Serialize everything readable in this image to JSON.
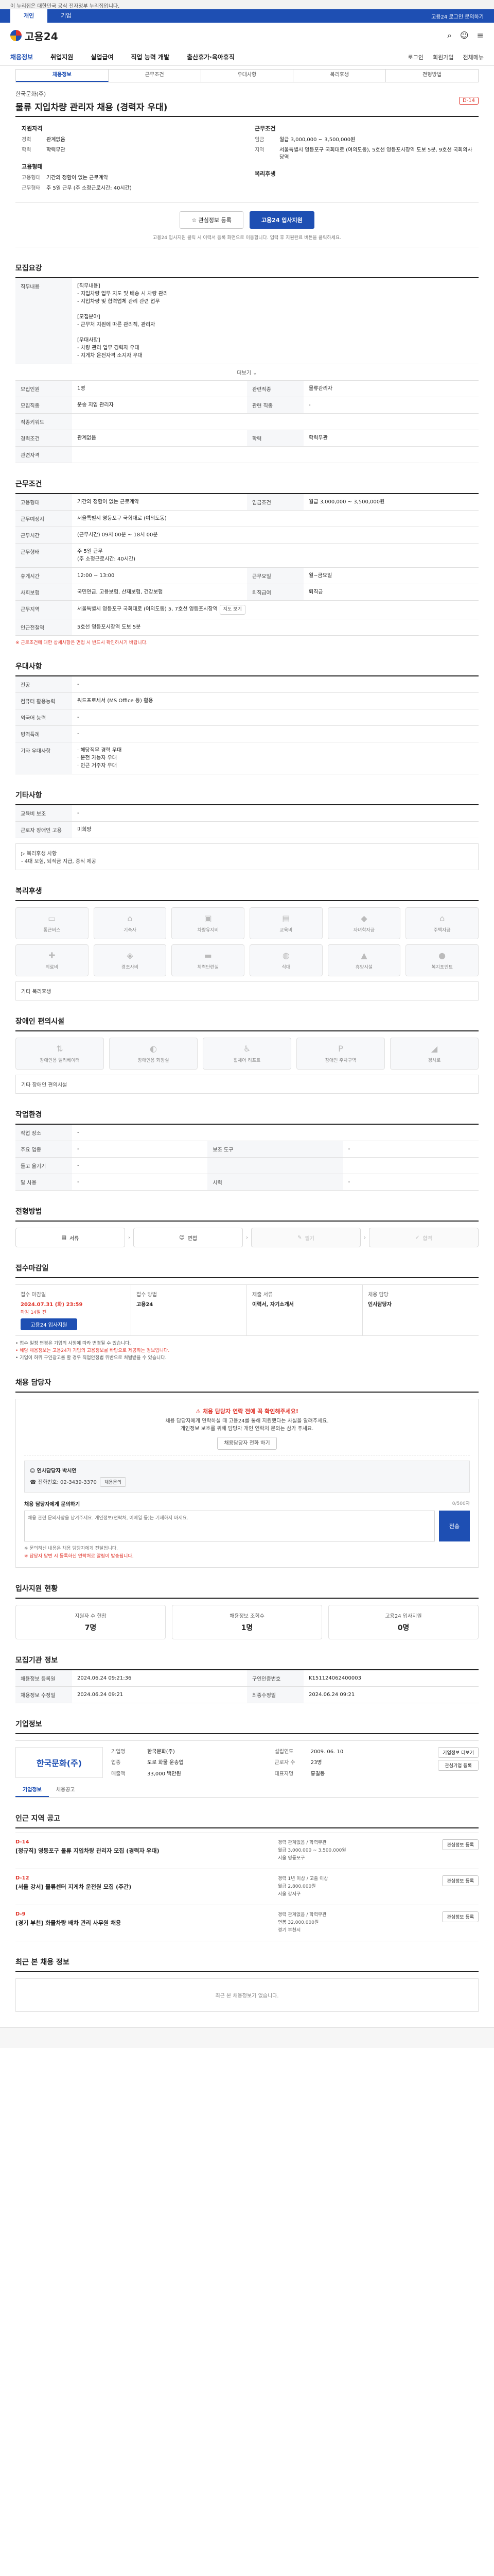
{
  "gov_bar": "이 누리집은 대한민국 공식 전자정부 누리집입니다.",
  "topnav": {
    "tabs": [
      "개인",
      "기업"
    ],
    "right": "고용24 로그인 문의하기"
  },
  "header": {
    "logo": "고용24"
  },
  "mainmenu": {
    "items": [
      "채용정보",
      "취업지원",
      "실업급여",
      "직업 능력 개발",
      "출산휴가·육아휴직"
    ],
    "right": [
      "로그인",
      "회원가입",
      "전체메뉴"
    ]
  },
  "subtabs": [
    "채용정보",
    "근무조건",
    "우대사항",
    "복리후생",
    "전형방법"
  ],
  "job": {
    "company": "한국문화(주)",
    "title": "물류 지입차량 관리자 채용 (경력자 우대)",
    "dday": "D-14"
  },
  "summary": {
    "left_title": "지원자격",
    "left": [
      {
        "k": "경력",
        "v": "관계없음"
      },
      {
        "k": "학력",
        "v": "학력무관"
      }
    ],
    "right_title": "근무조건",
    "right": [
      {
        "k": "임금",
        "v": "월급 3,000,000 ~ 3,500,000원"
      },
      {
        "k": "지역",
        "v": "서울특별시 영등포구 국회대로 (여의도동), 5호선 영등포시장역 도보 5분, 9호선 국회의사당역"
      }
    ],
    "left2_title": "고용형태",
    "left2": [
      {
        "k": "고용형태",
        "v": "기간의 정함이 없는 근로계약"
      },
      {
        "k": "근무형태",
        "v": "주 5일 근무 (주 소정근로시간: 40시간)"
      }
    ],
    "right2_title": "복리후생",
    "right2": []
  },
  "actions": {
    "save": "관심정보 등록",
    "apply": "고용24 입사지원",
    "notice": "고용24 입사지원 클릭 시 이력서 등록 화면으로 이동합니다. 입력 후 지원완료 버튼을 클릭하세요."
  },
  "recruit": {
    "title": "모집요강",
    "duty_label": "직무내용",
    "duty": "[직무내용]\n - 지입차량 업무 지도 및 배송 시 차량 관리\n - 지입차량 및 협력업체 관리 관련 업무\n\n[모집분야]\n - 근무처 지원에 따른 관리직, 관리자\n\n[우대사항]\n - 차량 관리 업무 경력자 우대\n - 지게차 운전자격 소지자 우대",
    "more": "더보기",
    "rows": [
      {
        "k": "모집인원",
        "v": "1명",
        "k2": "관련직종",
        "v2": "물류관리자"
      },
      {
        "k": "모집직종",
        "v": "운송 지입 관리자",
        "k2": "관련 직종",
        "v2": "-"
      },
      {
        "k": "직종키워드",
        "v": "",
        "k2": "",
        "v2": ""
      },
      {
        "k": "경력조건",
        "v": "관계없음",
        "k2": "학력",
        "v2": "학력무관"
      },
      {
        "k": "관련자격",
        "v": "",
        "k2": "",
        "v2": ""
      }
    ]
  },
  "conditions": {
    "title": "근무조건",
    "rows": [
      {
        "k": "고용형태",
        "v": "기간의 정함이 없는 근로계약",
        "k2": "임금조건",
        "v2": "월급 3,000,000 ~ 3,500,000원"
      },
      {
        "k": "근무예정지",
        "v": "서울특별시 영등포구 국회대로 (여의도동)"
      },
      {
        "k": "근무시간",
        "v": "(근무시간) 09시 00분 ~ 18시 00분"
      },
      {
        "k": "근무형태",
        "v": "주 5일 근무\n(주 소정근로시간: 40시간)"
      },
      {
        "k": "휴게시간",
        "v": "12:00 ~ 13:00",
        "k2": "근무요일",
        "v2": "월~금요일"
      },
      {
        "k": "사회보험",
        "v": "국민연금, 고용보험, 산재보험, 건강보험",
        "k2": "퇴직급여",
        "v2": "퇴직금"
      },
      {
        "k": "근무지역",
        "v": "서울특별시 영등포구 국회대로 (여의도동) 5, 7호선 영등포시장역"
      },
      {
        "k": "인근전철역",
        "v": "5호선 영등포시장역 도보 5분"
      }
    ],
    "note": "※ 근로조건에 대한 상세사항은 면접 시 반드시 확인하시기 바랍니다."
  },
  "preferences": {
    "title": "우대사항",
    "rows": [
      {
        "k": "전공",
        "v": "-"
      },
      {
        "k": "컴퓨터 활용능력",
        "v": "워드프로세서 (MS Office 등) 활용"
      },
      {
        "k": "외국어 능력",
        "v": "-"
      },
      {
        "k": "병역특례",
        "v": "-"
      },
      {
        "k": "기타 우대사항",
        "v": "· 해당직무 경력 우대\n· 운전 가능자 우대\n· 인근 거주자 우대"
      }
    ]
  },
  "welfare_detail": {
    "title": "기타사항",
    "rows": [
      {
        "k": "교육비 보조",
        "v": "-"
      },
      {
        "k": "근로자 장애인 고용",
        "v": "미희망"
      }
    ],
    "extra": "▷ 복리후생 사항\n - 4대 보험, 퇴직금 지급, 중식 제공"
  },
  "benefits": {
    "title": "복리후생",
    "items": [
      "통근버스",
      "기숙사",
      "차량유지비",
      "교육비",
      "자녀학자금",
      "주택자금",
      "의료비",
      "경조사비",
      "체력단련실",
      "식대",
      "휴양시설",
      "복지포인트"
    ]
  },
  "disability": {
    "title": "장애인 편의시설",
    "items": [
      "장애인용 엘리베이터",
      "장애인용 화장실",
      "휠체어 리프트",
      "장애인 주차구역",
      "경사로"
    ],
    "etc": "기타 장애인 편의시설"
  },
  "workplace": {
    "title": "작업환경",
    "rows": [
      {
        "k": "작업 장소",
        "v": "-"
      },
      {
        "k": "주요 업종",
        "v": "-",
        "k2": "보조 도구",
        "v2": "-"
      },
      {
        "k": "들고 옮기기",
        "v": "-",
        "k2": "",
        "v2": ""
      },
      {
        "k": "말 사용",
        "v": "-",
        "k2": "시력",
        "v2": "-"
      }
    ]
  },
  "process": {
    "title": "전형방법",
    "steps": [
      "서류",
      "면접",
      "필기",
      "합격"
    ]
  },
  "apply": {
    "title": "접수마감일",
    "deadline_label": "접수 마감일",
    "deadline": "2024.07.31 (화) 23:59",
    "deadline_red": "마감 14일 전",
    "method_label": "접수 방법",
    "method": "고용24",
    "docs_label": "제출 서류",
    "docs": "이력서, 자기소개서",
    "contact_label": "채용 담당",
    "contact": "인사담당자",
    "button": "고용24 입사지원",
    "notes": [
      "접수 일정 변경은 기업의 사정에 따라 변경될 수 있습니다.",
      "해당 채용정보는 고용24가 기업의 고용정보를 바탕으로 제공하는 정보입니다.",
      "기업이 허위 구인광고를 할 경우 직업안정법 위반으로 처벌받을 수 있습니다."
    ]
  },
  "contact": {
    "title": "채용 담당자",
    "warn_title": "채용 담당자 연락 전에 꼭 확인해주세요!",
    "warn": "채용 담당자에게 연락하실 때 고용24를 통해 지원했다는 사실을 알려주세요.\n개인정보 보호를 위해 담당자 개인 연락처 문의는 삼가 주세요.",
    "warn_btn": "채용담당자 전화 하기",
    "name": "인사담당자 박시연",
    "tel": "전화번호: 02-3439-3370",
    "more_btn": "채용문의"
  },
  "inquiry": {
    "title": "채용 담당자에게 문의하기",
    "count": "0/500자",
    "placeholder": "채용 관련 문의사항을 남겨주세요. 개인정보(연락처, 이메일 등)는 기재하지 마세요.",
    "send": "전송",
    "note1": "※ 문의하신 내용은 채용 담당자에게 전달됩니다.",
    "note2": "※ 담당자 답변 시 등록하신 연락처로 알림이 발송됩니다."
  },
  "stats": {
    "title": "입사지원 현황",
    "items": [
      {
        "label": "지원자 수 현황",
        "value": "7명"
      },
      {
        "label": "채용정보 조회수",
        "value": "1명"
      },
      {
        "label": "고용24 입사지원",
        "value": "0명"
      }
    ]
  },
  "meta": {
    "title": "모집기관 정보",
    "rows": [
      {
        "k": "채용정보 등록일",
        "v": "2024.06.24 09:21:36",
        "k2": "구인인증번호",
        "v2": "K151124062400003"
      },
      {
        "k": "채용정보 수정일",
        "v": "2024.06.24 09:21",
        "k2": "최종수정일",
        "v2": "2024.06.24 09:21"
      }
    ]
  },
  "company": {
    "title": "기업정보",
    "logo": "한국문화(주)",
    "info": [
      {
        "k": "기업명",
        "v": "한국문화(주)"
      },
      {
        "k": "설립연도",
        "v": "2009. 06. 10"
      },
      {
        "k": "업종",
        "v": "도로 화물 운송업"
      },
      {
        "k": "근로자 수",
        "v": "23명"
      },
      {
        "k": "매출액",
        "v": "33,000 백만원"
      },
      {
        "k": "대표자명",
        "v": "홍길동"
      }
    ],
    "btns": [
      "기업정보 더보기",
      "관심기업 등록"
    ],
    "tabs": [
      "기업정보",
      "채용공고"
    ]
  },
  "similar": {
    "title": "인근 지역 공고",
    "jobs": [
      {
        "dday": "D-14",
        "title": "[정규직] 영등포구 물류 지입차량 관리자 모집 (경력자 우대)",
        "meta": "경력 관계없음 / 학력무관\n월급 3,000,000 ~ 3,500,000원\n서울 영등포구",
        "btn": "관심정보 등록"
      },
      {
        "dday": "D-12",
        "title": "[서울 강서] 물류센터 지게차 운전원 모집 (주간)",
        "meta": "경력 1년 이상 / 고졸 이상\n월급 2,800,000원\n서울 강서구",
        "btn": "관심정보 등록"
      },
      {
        "dday": "D-9",
        "title": "[경기 부천] 화물차량 배차 관리 사무원 채용",
        "meta": "경력 관계없음 / 학력무관\n연봉 32,000,000원\n경기 부천시",
        "btn": "관심정보 등록"
      }
    ]
  },
  "recent": {
    "title": "최근 본 채용 정보",
    "empty": "최근 본 채용정보가 없습니다."
  }
}
